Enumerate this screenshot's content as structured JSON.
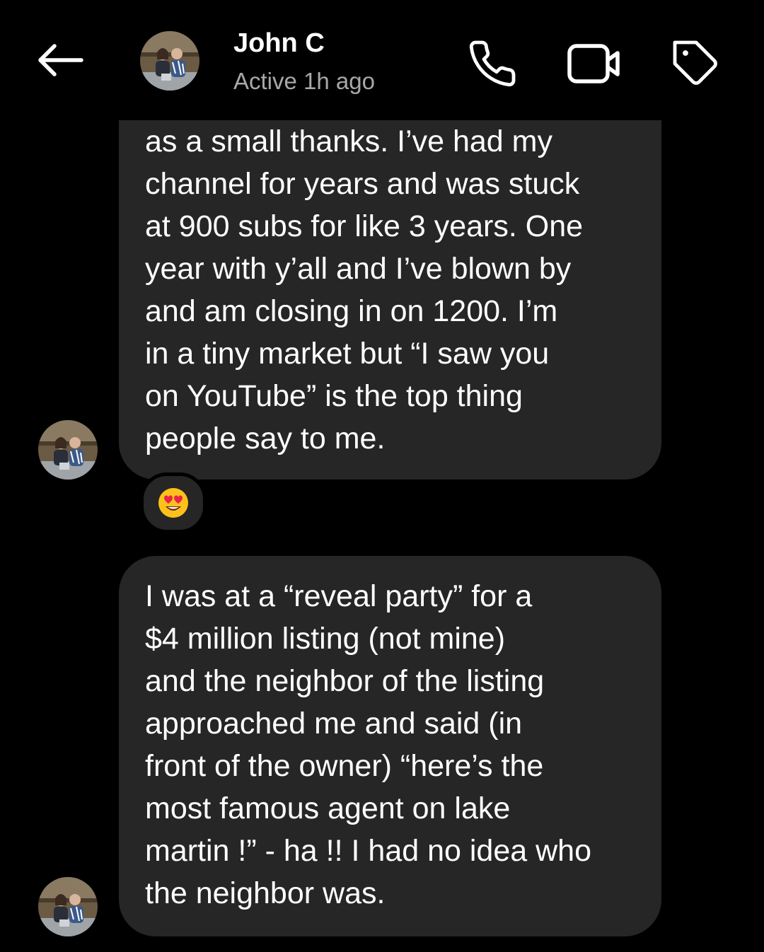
{
  "header": {
    "name": "John C",
    "status": "Active 1h ago",
    "icons": {
      "back": "arrow-left-icon",
      "call": "phone-icon",
      "video": "video-camera-icon",
      "tag": "tag-icon"
    }
  },
  "messages": [
    {
      "sender": "John C",
      "text": "as a small thanks. I’ve had my\nchannel for years and was stuck\nat 900 subs for like 3 years. One\nyear with y’all and I’ve blown by\nand am closing in on 1200. I’m\nin a tiny market but “I saw you\non YouTube” is the top thing\npeople say to me.",
      "reaction": "heart-eyes-emoji"
    },
    {
      "sender": "John C",
      "text": "I was at a “reveal party” for a\n$4 million listing (not mine)\nand the neighbor of the listing\napproached me and said (in\nfront of the owner) “here’s the\nmost famous agent on lake\nmartin !” - ha !! I had no idea who\nthe neighbor was."
    }
  ],
  "colors": {
    "background": "#000000",
    "bubble": "#262626",
    "text": "#ffffff",
    "status_text": "#a8a8a8"
  }
}
